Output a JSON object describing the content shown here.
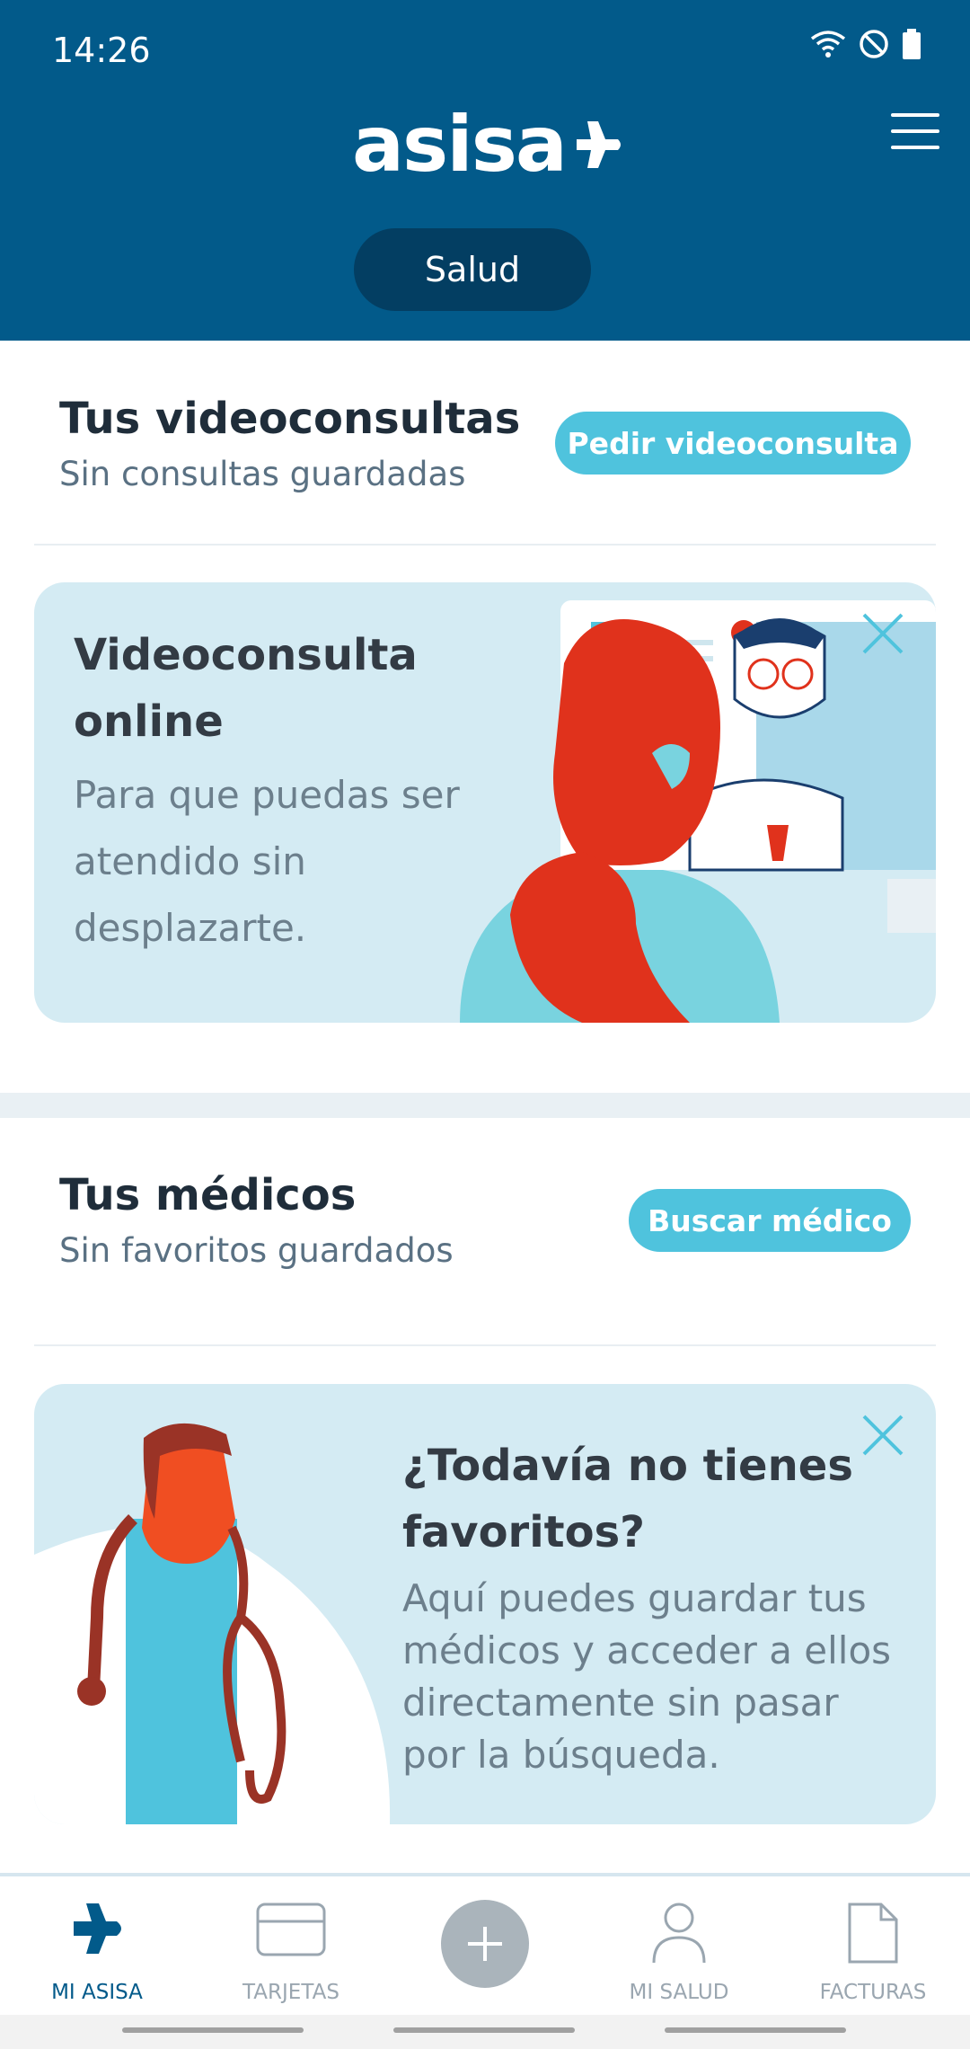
{
  "status_bar": {
    "time": "14:26",
    "icons": [
      "wifi-icon",
      "do-not-disturb-icon",
      "battery-icon"
    ]
  },
  "header": {
    "logo_text": "asisa",
    "menu_icon": "hamburger-menu-icon",
    "segment_label": "Salud"
  },
  "videoconsultas": {
    "title": "Tus videoconsultas",
    "subtitle": "Sin consultas guardadas",
    "button_label": "Pedir videoconsulta"
  },
  "video_card": {
    "title_line1": "Videoconsulta",
    "title_line2": "online",
    "body_line1": "Para que puedas ser",
    "body_line2": "atendido sin",
    "body_line3": "desplazarte."
  },
  "medicos": {
    "title": "Tus médicos",
    "subtitle": "Sin favoritos guardados",
    "button_label": "Buscar médico"
  },
  "favorites_card": {
    "title_line1": "¿Todavía no tienes",
    "title_line2": "favoritos?",
    "body_line1": "Aquí puedes guardar tus",
    "body_line2": "médicos y acceder a ellos",
    "body_line3": "directamente sin pasar",
    "body_line4": "por la búsqueda."
  },
  "tabbar": {
    "tabs": [
      {
        "label": "MI ASISA",
        "icon": "asisa-plane-icon",
        "active": true
      },
      {
        "label": "TARJETAS",
        "icon": "card-icon",
        "active": false
      },
      {
        "label": "",
        "icon": "plus-icon",
        "active": false
      },
      {
        "label": "MI SALUD",
        "icon": "person-icon",
        "active": false
      },
      {
        "label": "FACTURAS",
        "icon": "document-icon",
        "active": false
      }
    ]
  },
  "colors": {
    "brand_blue": "#025a8a",
    "accent_cyan": "#4fc3dd",
    "card_bg": "#d4ebf3",
    "illustration_red": "#e0321c"
  }
}
